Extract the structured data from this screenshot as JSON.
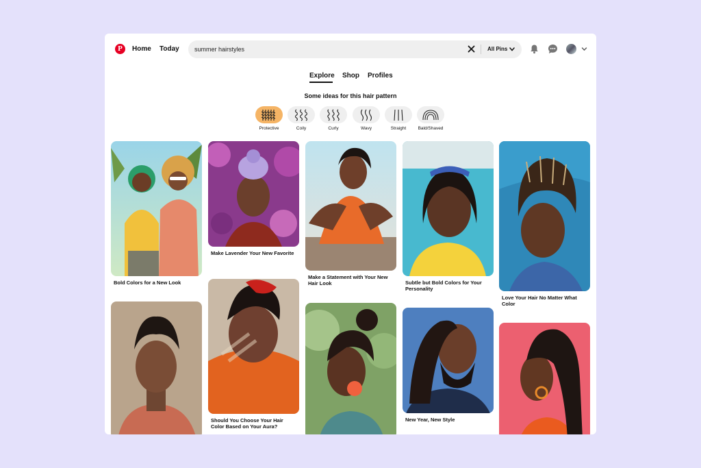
{
  "header": {
    "logo": "P",
    "home_label": "Home",
    "today_label": "Today",
    "search_value": "summer hairstyles",
    "filter_label": "All Pins",
    "icons": [
      "pinterest-logo-icon",
      "close-icon",
      "chevron-down-icon",
      "bell-icon",
      "chat-icon",
      "avatar",
      "chevron-down-icon"
    ]
  },
  "tabs": [
    {
      "label": "Explore",
      "active": true
    },
    {
      "label": "Shop",
      "active": false
    },
    {
      "label": "Profiles",
      "active": false
    }
  ],
  "ideas_title": "Some ideas for this hair pattern",
  "hair_patterns": [
    {
      "label": "Protective",
      "active": true
    },
    {
      "label": "Coily",
      "active": false
    },
    {
      "label": "Curly",
      "active": false
    },
    {
      "label": "Wavy",
      "active": false
    },
    {
      "label": "Straight",
      "active": false
    },
    {
      "label": "Bald/Shaved",
      "active": false
    }
  ],
  "pins": [
    {
      "title": "Bold Colors for a New Look"
    },
    {
      "title": ""
    },
    {
      "title": "Make Lavender Your New Favorite"
    },
    {
      "title": "Should You Choose Your Hair Color Based on Your Aura?"
    },
    {
      "title": "Make a Statement with Your New Hair Look"
    },
    {
      "title": ""
    },
    {
      "title": "Subtle but Bold Colors for Your Personality"
    },
    {
      "title": "New Year, New Style"
    },
    {
      "title": "Love Your Hair No Matter What Color"
    },
    {
      "title": ""
    }
  ],
  "colors": {
    "page_background": "#e4e1fb",
    "brand_red": "#e60023",
    "active_chip": "#f5b465",
    "chip": "#efefef"
  }
}
